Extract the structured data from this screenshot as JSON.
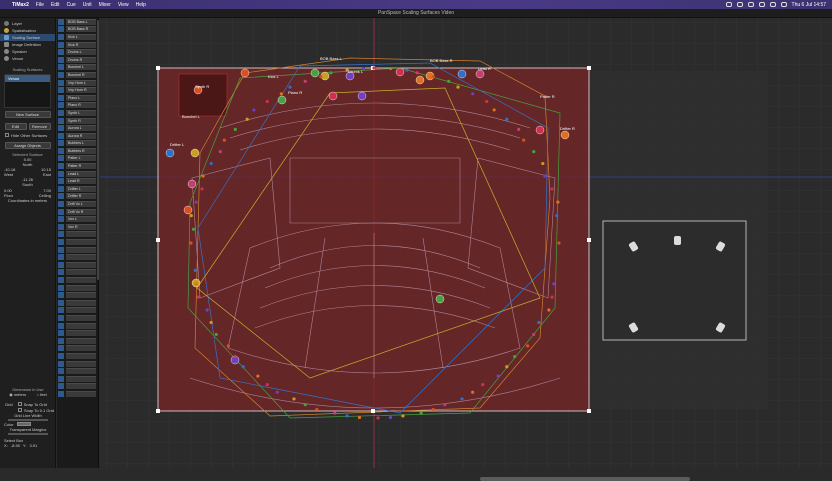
{
  "menubar": {
    "app": "TiMax2",
    "items": [
      "File",
      "Edit",
      "Cue",
      "Unit",
      "Mixer",
      "View",
      "Help"
    ],
    "clock": "Thu 6 Jul  14:57"
  },
  "window_title": "PanSpace Scaling Surfaces Video",
  "left_panel": {
    "tools": [
      "Layer",
      "Spatialisation",
      "Scaling Surface",
      "Image Definition",
      "Speaker",
      "Venue"
    ],
    "active_tool_index": 2,
    "scaling_surfaces_label": "Scaling Surfaces",
    "surfaces": [
      "Venue"
    ],
    "new_surface": "New Surface",
    "edit": "Edit",
    "remove": "Remove",
    "hide_other": "Hide Other Surfaces",
    "assign_objects": "Assign Objects",
    "selected_surface_label": "Selected Surface",
    "top_value": "5.00",
    "north": "North",
    "west_value": "-10.18",
    "east_value": "10.15",
    "west": "West",
    "east": "East",
    "center_value": "-11.26",
    "south": "South",
    "floor_value": "0.00",
    "ceiling_value": "7.00",
    "floor": "Floor",
    "ceiling": "Ceiling",
    "coords_note": "Coordinates in meters",
    "dimension_label": "Dimension in Use",
    "meters": "meters",
    "feet": "feet",
    "grid": "Grid",
    "snap_grid": "Snap To Grid",
    "snap_grid01": "Snap To 0.1 Grid",
    "grid_line_width": "Grid Line Width",
    "color": "Color",
    "transparent_margins": "Transparent Margins",
    "select_box": "Select Box",
    "select_x": "-8.55",
    "select_y": "3.91",
    "x": "X:",
    "y": "Y:"
  },
  "channels": [
    "BOB Bass L",
    "BOB Bass R",
    "Kick L",
    "Kick R",
    "Drums L",
    "Drums R",
    "Bonchel L",
    "Bonchel R",
    "Vxp Horn L",
    "Vxp Horn R",
    "Piano L",
    "Piano R",
    "Synth L",
    "Synth R",
    "Aurora L",
    "Aurora R",
    "Bubbles L",
    "Bubbles R",
    "Patter L",
    "Patter R",
    "Lead L",
    "Lead R",
    "Drifter L",
    "Drifter R",
    "Drift Vo L",
    "Drift Vo R",
    "Vox L",
    "Vox R",
    "",
    "",
    "",
    "",
    "",
    "",
    "",
    "",
    "",
    "",
    "",
    "",
    "",
    "",
    "",
    "",
    "",
    "",
    "",
    "",
    "",
    ""
  ],
  "stage": {
    "dot_labels": [
      "BOB Bass L",
      "Drums L",
      "BOB Bass R",
      "Kick L",
      "Lead R",
      "Synth R",
      "Piano R",
      "Drifter L",
      "Drifter R",
      "Patter R",
      "Bonchel L"
    ],
    "speaker_count": 6
  },
  "colors": {
    "surface_fill": "#8a2a2a",
    "surface_border": "#ffffff",
    "accent": "#2f5a8c"
  }
}
